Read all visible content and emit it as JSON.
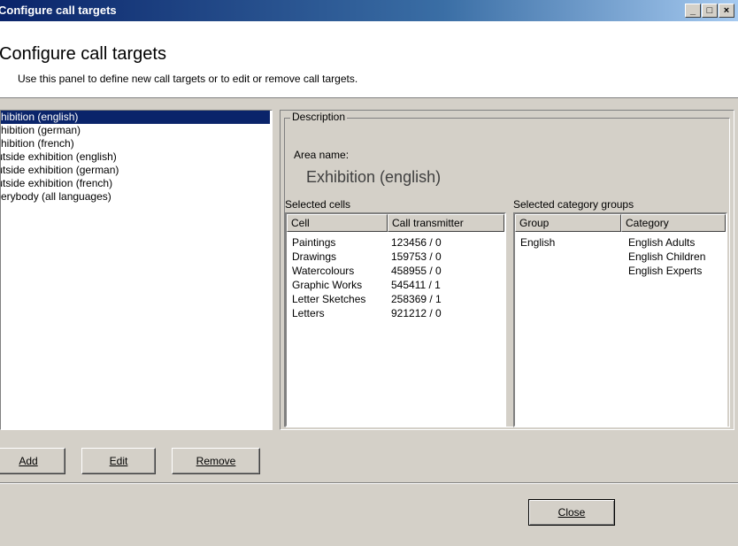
{
  "window": {
    "title": "Configure call targets",
    "minimize_glyph": "_",
    "maximize_glyph": "□",
    "close_glyph": "×"
  },
  "header": {
    "heading": "Configure call targets",
    "description": "Use this panel to define new call targets or to edit or remove call targets."
  },
  "targets": [
    {
      "label": "Exhibition (english)",
      "selected": true
    },
    {
      "label": "Exhibition (german)",
      "selected": false
    },
    {
      "label": "Exhibition (french)",
      "selected": false
    },
    {
      "label": "Outside exhibition (english)",
      "selected": false
    },
    {
      "label": "Outside exhibition (german)",
      "selected": false
    },
    {
      "label": "Outside exhibition (french)",
      "selected": false
    },
    {
      "label": "Everybody (all languages)",
      "selected": false
    }
  ],
  "description_panel": {
    "legend": "Description",
    "area_label": "Area name:",
    "area_name": "Exhibition (english)",
    "cells_label": "Selected cells",
    "cells_columns": [
      "Cell",
      "Call transmitter"
    ],
    "cells": [
      {
        "cell": "Paintings",
        "transmitter": "123456 / 0"
      },
      {
        "cell": "Drawings",
        "transmitter": "159753 / 0"
      },
      {
        "cell": "Watercolours",
        "transmitter": "458955 / 0"
      },
      {
        "cell": "Graphic Works",
        "transmitter": "545411 / 1"
      },
      {
        "cell": "Letter Sketches",
        "transmitter": "258369 / 1"
      },
      {
        "cell": "Letters",
        "transmitter": "921212 / 0"
      }
    ],
    "groups_label": "Selected category groups",
    "groups_columns": [
      "Group",
      "Category"
    ],
    "groups": [
      {
        "group": "English",
        "category": "English Adults"
      },
      {
        "group": "",
        "category": "English Children"
      },
      {
        "group": "",
        "category": "English Experts"
      }
    ]
  },
  "buttons": {
    "add": "Add",
    "edit": "Edit",
    "remove": "Remove",
    "close": "Close"
  },
  "colors": {
    "titlebar": "#0a246a",
    "selection": "#0a246a",
    "face": "#d4d0c8"
  }
}
